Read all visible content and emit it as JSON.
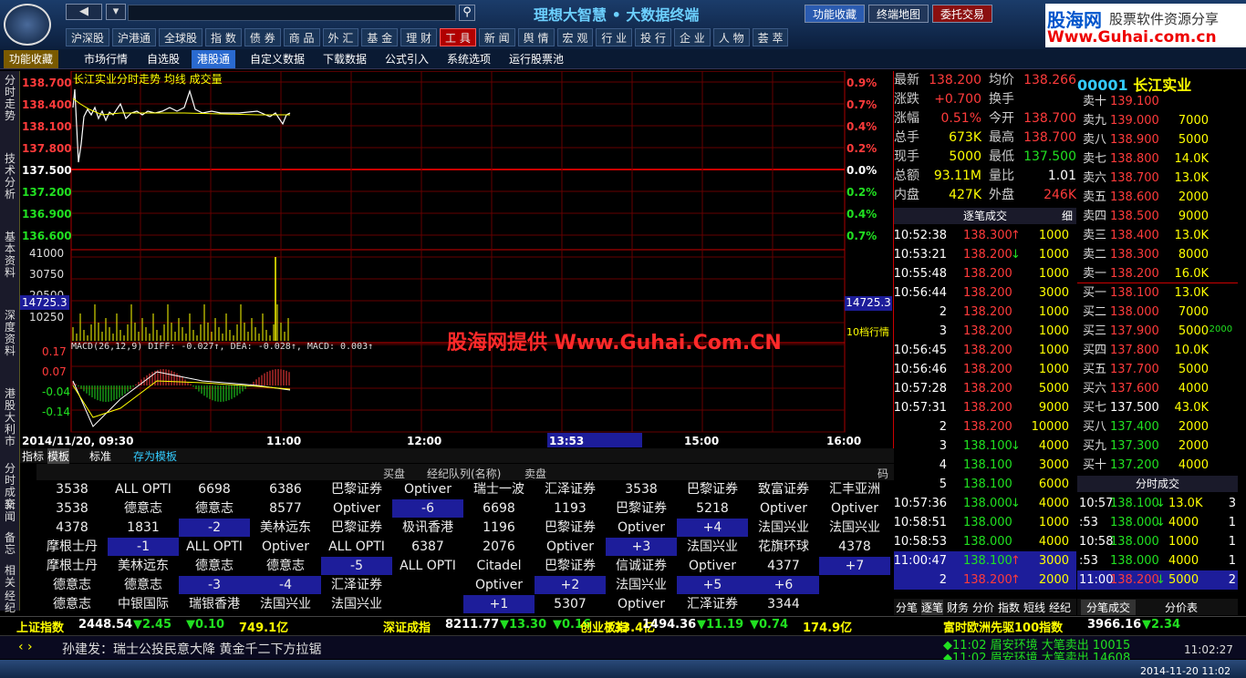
{
  "app": {
    "title": "理想大智慧 • 大数据终端",
    "btn_fav": "功能收藏",
    "btn_map": "终端地图",
    "btn_trade": "委托交易",
    "brand1": "股海网",
    "brand2": "股票软件资源分享",
    "brand3": "Www.Guhai.com.cn"
  },
  "menu": [
    "沪深股",
    "沪港通",
    "全球股",
    "指 数",
    "债 券",
    "商 品",
    "外 汇",
    "基 金",
    "理 财",
    "工 具",
    "新 闻",
    "舆 情",
    "宏 观",
    "行 业",
    "投 行",
    "企 业",
    "人 物",
    "荟 萃"
  ],
  "menu_active": 9,
  "toolbar": [
    "功能收藏",
    "市场行情",
    "自选股",
    "港股通",
    "自定义数据",
    "下载数据",
    "公式引入",
    "系统选项",
    "运行股票池"
  ],
  "toolbar_active": 3,
  "sidetabs": [
    "分时走势",
    "技术分析",
    "基本资料",
    "深度资料",
    "港股大利市",
    "分时成交",
    "新闻",
    "备忘",
    "相关",
    "经纪"
  ],
  "chart": {
    "header": "长江实业分时走势 均线 成交量",
    "price_labels": [
      "138.700",
      "138.400",
      "138.100",
      "137.800",
      "137.500",
      "137.200",
      "136.900",
      "136.600"
    ],
    "pct_labels": [
      "0.9%",
      "0.7%",
      "0.4%",
      "0.2%",
      "0.0%",
      "0.2%",
      "0.4%",
      "0.7%"
    ],
    "vol_labels": [
      "41000",
      "30750",
      "20500",
      "10250"
    ],
    "vol_marker": "14725.3",
    "macd_header": "MACD(26,12,9) DIFF: -0.027↑, DEA: -0.028↑, MACD: 0.003↑",
    "macd_labels": [
      "0.17",
      "0.07",
      "-0.04",
      "-0.14"
    ],
    "time_labels": [
      "2014/11/20, 09:30",
      "11:00",
      "12:00",
      "13:53",
      "15:00",
      "16:00"
    ],
    "watermark": "股海网提供 Www.Guhai.Com.CN",
    "level10": "10档行情",
    "tabs": [
      "指标",
      "模板",
      "标准",
      "存为模板"
    ]
  },
  "broker": {
    "header": [
      "买盘",
      "经纪队列(名称)",
      "卖盘",
      "码"
    ],
    "rows": [
      [
        "3538",
        "ALL OPTI",
        "6698",
        "6386",
        "巴黎证券",
        "Optiver",
        "瑞士一波",
        "汇泽证券",
        "3538",
        "巴黎证券",
        "致富证券",
        "汇丰亚洲"
      ],
      [
        "3538",
        "德意志",
        "德意志",
        "8577",
        "Optiver",
        "-6",
        "6698",
        "1193",
        "巴黎证券",
        "5218",
        "Optiver",
        "Optiver"
      ],
      [
        "4378",
        "1831",
        "-2",
        "美林远东",
        "巴黎证券",
        "极讯香港",
        "1196",
        "巴黎证券",
        "Optiver",
        "+4",
        "法国兴业",
        "法国兴业"
      ],
      [
        "摩根士丹",
        "-1",
        "ALL OPTI",
        "Optiver",
        "ALL OPTI",
        "6387",
        "2076",
        "Optiver",
        "+3",
        "法国兴业",
        "花旗环球",
        "4378"
      ],
      [
        "摩根士丹",
        "美林远东",
        "德意志",
        "德意志",
        "-5",
        "ALL OPTI",
        "Citadel",
        "巴黎证券",
        "信诚证券",
        "Optiver",
        "4377",
        "+7"
      ],
      [
        "德意志",
        "德意志",
        "-3",
        "-4",
        "汇泽证券",
        "",
        "Optiver",
        "+2",
        "法国兴业",
        "+5",
        "+6",
        ""
      ],
      [
        "德意志",
        "中银国际",
        "瑞银香港",
        "法国兴业",
        "法国兴业",
        "",
        "+1",
        "5307",
        "Optiver",
        "汇泽证券",
        "3344",
        ""
      ]
    ]
  },
  "quote": {
    "rows": [
      [
        "最新",
        "138.200",
        "均价",
        "138.266"
      ],
      [
        "涨跌",
        "+0.700",
        "换手",
        ""
      ],
      [
        "涨幅",
        "0.51%",
        "今开",
        "138.700"
      ],
      [
        "总手",
        "673K",
        "最高",
        "138.700"
      ],
      [
        "现手",
        "5000",
        "最低",
        "137.500"
      ],
      [
        "总额",
        "93.11M",
        "量比",
        "1.01"
      ],
      [
        "内盘",
        "427K",
        "外盘",
        "246K"
      ]
    ],
    "tick_title": "逐笔成交",
    "tick_btn": "细"
  },
  "ticks": [
    [
      "10:52:38",
      "138.300",
      "↑",
      "1000"
    ],
    [
      "10:53:21",
      "138.200",
      "↓",
      "1000"
    ],
    [
      "10:55:48",
      "138.200",
      "",
      "1000"
    ],
    [
      "10:56:44",
      "138.200",
      "",
      "3000"
    ],
    [
      "2",
      "138.200",
      "",
      "1000"
    ],
    [
      "3",
      "138.200",
      "",
      "1000"
    ],
    [
      "10:56:45",
      "138.200",
      "",
      "1000"
    ],
    [
      "10:56:46",
      "138.200",
      "",
      "1000"
    ],
    [
      "10:57:28",
      "138.200",
      "",
      "5000"
    ],
    [
      "10:57:31",
      "138.200",
      "",
      "9000"
    ],
    [
      "2",
      "138.200",
      "",
      "10000"
    ],
    [
      "3",
      "138.100",
      "↓",
      "4000"
    ],
    [
      "4",
      "138.100",
      "",
      "3000"
    ],
    [
      "5",
      "138.100",
      "",
      "6000"
    ],
    [
      "10:57:36",
      "138.000",
      "↓",
      "4000"
    ],
    [
      "10:58:51",
      "138.000",
      "",
      "1000"
    ],
    [
      "10:58:53",
      "138.000",
      "",
      "4000"
    ],
    [
      "11:00:47",
      "138.100",
      "↑",
      "3000"
    ],
    [
      "2",
      "138.200",
      "↑",
      "2000"
    ]
  ],
  "tick_tabs": [
    "分笔",
    "逐笔",
    "财务",
    "分价",
    "指数",
    "短线",
    "经纪"
  ],
  "stock": {
    "code": "00001",
    "name": "长江实业"
  },
  "orderbook": [
    [
      "卖十",
      "139.100",
      ""
    ],
    [
      "卖九",
      "139.000",
      "7000"
    ],
    [
      "卖八",
      "138.900",
      "5000"
    ],
    [
      "卖七",
      "138.800",
      "14.0K"
    ],
    [
      "卖六",
      "138.700",
      "13.0K"
    ],
    [
      "卖五",
      "138.600",
      "2000"
    ],
    [
      "卖四",
      "138.500",
      "9000"
    ],
    [
      "卖三",
      "138.400",
      "13.0K"
    ],
    [
      "卖二",
      "138.300",
      "8000"
    ],
    [
      "卖一",
      "138.200",
      "16.0K"
    ],
    [
      "买一",
      "138.100",
      "13.0K"
    ],
    [
      "买二",
      "138.000",
      "7000"
    ],
    [
      "买三",
      "137.900",
      "5000"
    ],
    [
      "买四",
      "137.800",
      "10.0K"
    ],
    [
      "买五",
      "137.700",
      "5000"
    ],
    [
      "买六",
      "137.600",
      "4000"
    ],
    [
      "买七",
      "137.500",
      "43.0K"
    ],
    [
      "买八",
      "137.400",
      "2000"
    ],
    [
      "买九",
      "137.300",
      "2000"
    ],
    [
      "买十",
      "137.200",
      "4000"
    ]
  ],
  "ob_side": "-2000",
  "split": {
    "title": "分时成交",
    "rows": [
      [
        "10:57",
        "138.100",
        "↓",
        "13.0K",
        "3"
      ],
      [
        ":53",
        "138.000",
        "↓",
        "4000",
        "1"
      ],
      [
        "10:58",
        "138.000",
        "",
        "1000",
        "1"
      ],
      [
        ":53",
        "138.000",
        "",
        "4000",
        "1"
      ],
      [
        "11:00",
        "138.200",
        "↓",
        "5000",
        "2"
      ]
    ],
    "tabs": [
      "分笔成交",
      "分价表"
    ]
  },
  "status": [
    [
      "上证指数",
      "2448.54",
      "▼2.45",
      "▼0.10",
      "749.1亿"
    ],
    [
      "深证成指",
      "8211.77",
      "▼13.30",
      "▼0.16",
      "733.4亿"
    ],
    [
      "创业板指",
      "1494.36",
      "▼11.19",
      "▼0.74",
      "174.9亿"
    ],
    [
      "富时欧洲先驱100指数",
      "3966.16",
      "▼2.34",
      ""
    ]
  ],
  "news": "孙建发：瑞士公投民意大降 黄金千二下方拉锯",
  "alerts": [
    "◆11:02 眉安环境 大笔卖出 10015",
    "◆11:02 眉安环境 大笔卖出 14608"
  ],
  "clock": "11:02:27",
  "taskbar_date": "2014-11-20 11:02"
}
